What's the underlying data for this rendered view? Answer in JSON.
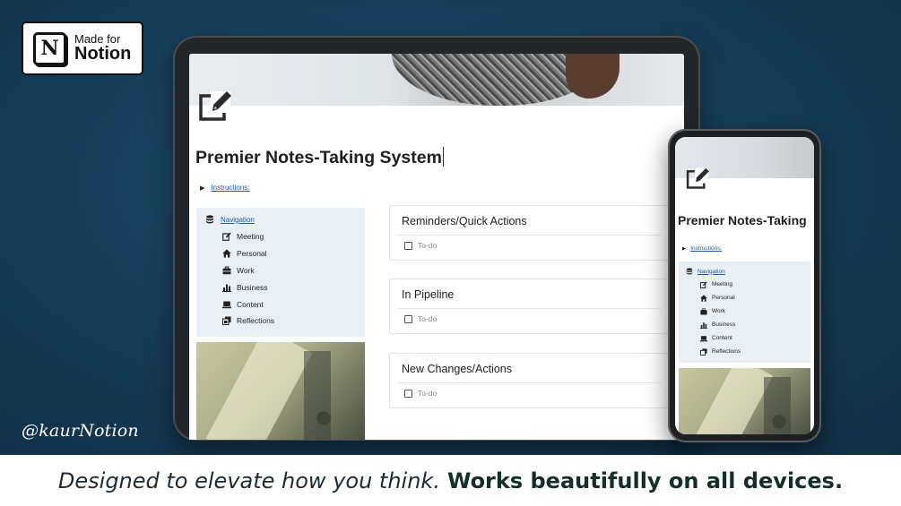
{
  "badge": {
    "line1": "Made for",
    "line2": "Notion",
    "logo_letter": "N"
  },
  "handle": "@kaurNotion",
  "caption": {
    "light": "Designed to elevate how you think.",
    "bold": "Works beautifully on all devices."
  },
  "page": {
    "title": "Premier Notes-Taking System",
    "toggle_label": "Instructions:",
    "navigation": {
      "label": "Navigation",
      "items": [
        {
          "label": "Meeting",
          "icon": "edit-icon"
        },
        {
          "label": "Personal",
          "icon": "home-icon"
        },
        {
          "label": "Work",
          "icon": "briefcase-icon"
        },
        {
          "label": "Business",
          "icon": "bar-chart-icon"
        },
        {
          "label": "Content",
          "icon": "laptop-icon"
        },
        {
          "label": "Reflections",
          "icon": "gallery-icon"
        }
      ]
    },
    "cards": [
      {
        "title": "Reminders/Quick Actions",
        "todo": "To-do"
      },
      {
        "title": "In Pipeline",
        "todo": "To-do"
      },
      {
        "title": "New Changes/Actions",
        "todo": "To-do"
      }
    ]
  },
  "phone_page": {
    "title": "Premier Notes-Taking"
  },
  "colors": {
    "background": "#173f5b",
    "nav_panel": "#e8f0f6",
    "link": "#1f5aa6",
    "caption_bold": "#142f2a"
  }
}
